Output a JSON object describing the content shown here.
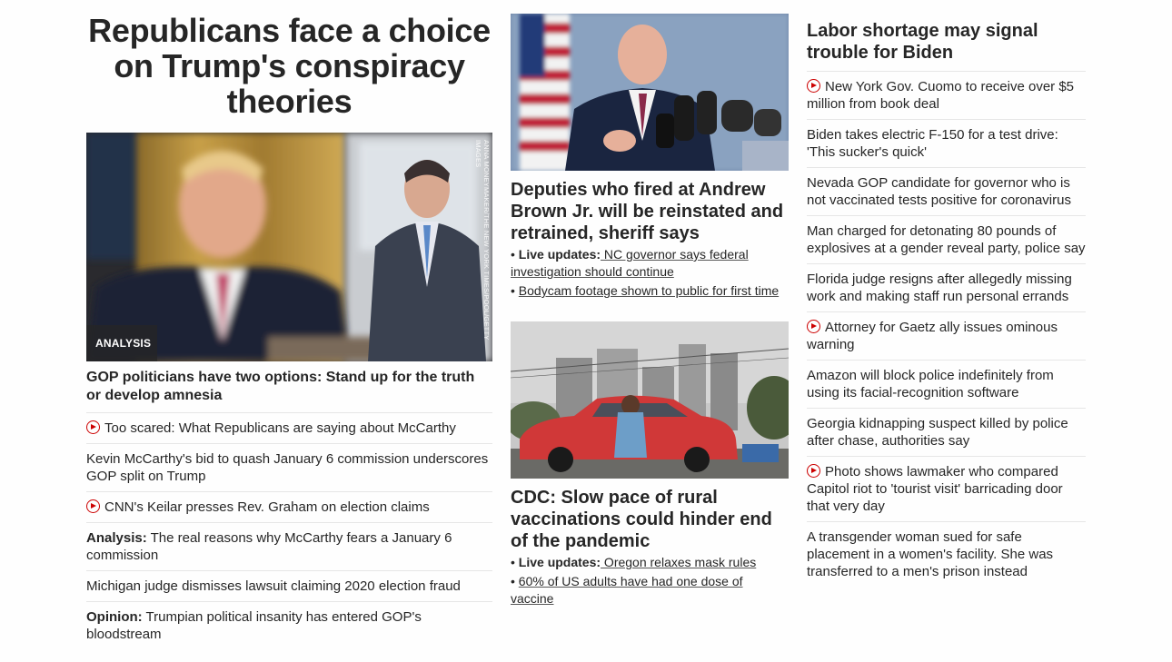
{
  "column1": {
    "headline": "Republicans face a choice on Trump's conspiracy theories",
    "badge": "ANALYSIS",
    "photo_credit": "ANNA MONEYMAKER/THE NEW YORK TIMES/POOL/GETTY IMAGES",
    "subheadline": "GOP politicians have two options: Stand up for the truth or develop amnesia",
    "items": [
      {
        "video": true,
        "prefix": "",
        "text": "Too scared: What Republicans are saying about McCarthy"
      },
      {
        "video": false,
        "prefix": "",
        "text": "Kevin McCarthy's bid to quash January 6 commission underscores GOP split on Trump"
      },
      {
        "video": true,
        "prefix": "",
        "text": "CNN's Keilar presses Rev. Graham on election claims"
      },
      {
        "video": false,
        "prefix": "Analysis:",
        "text": " The real reasons why McCarthy fears a January 6 commission"
      },
      {
        "video": false,
        "prefix": "",
        "text": "Michigan judge dismisses lawsuit claiming 2020 election fraud"
      },
      {
        "video": false,
        "prefix": "Opinion:",
        "text": " Trumpian political insanity has entered GOP's bloodstream"
      }
    ]
  },
  "column2": {
    "story1": {
      "headline": "Deputies who fired at Andrew Brown Jr. will be reinstated and retrained, sheriff says",
      "bullets": [
        {
          "prefix": "Live updates:",
          "text": " NC governor says federal investigation should continue"
        },
        {
          "prefix": "",
          "text": "Bodycam footage shown to public for first time"
        }
      ]
    },
    "story2": {
      "headline": "CDC: Slow pace of rural vaccinations could hinder end of the pandemic",
      "bullets": [
        {
          "prefix": "Live updates:",
          "text": " Oregon relaxes mask rules"
        },
        {
          "prefix": "",
          "text": "60% of US adults have had one dose of vaccine"
        }
      ]
    }
  },
  "column3": {
    "headline": "Labor shortage may signal trouble for Biden",
    "items": [
      {
        "video": true,
        "text": "New York Gov. Cuomo to receive over $5 million from book deal"
      },
      {
        "video": false,
        "text": "Biden takes electric F-150 for a test drive: 'This sucker's quick'"
      },
      {
        "video": false,
        "text": "Nevada GOP candidate for governor who is not vaccinated tests positive for coronavirus"
      },
      {
        "video": false,
        "text": "Man charged for detonating 80 pounds of explosives at a gender reveal party, police say"
      },
      {
        "video": false,
        "text": "Florida judge resigns after allegedly missing work and making staff run personal errands"
      },
      {
        "video": true,
        "text": "Attorney for Gaetz ally issues ominous warning"
      },
      {
        "video": false,
        "text": "Amazon will block police indefinitely from using its facial-recognition software"
      },
      {
        "video": false,
        "text": "Georgia kidnapping suspect killed by police after chase, authorities say"
      },
      {
        "video": true,
        "text": "Photo shows lawmaker who compared Capitol riot to 'tourist visit' barricading door that very day"
      },
      {
        "video": false,
        "text": "A transgender woman sued for safe placement in a women's facility. She was transferred to a men's prison instead"
      }
    ]
  },
  "icons": {
    "video": "play-circle-icon"
  },
  "colors": {
    "accent": "#cc0000",
    "text": "#262626",
    "divider": "#e6e6e6"
  }
}
